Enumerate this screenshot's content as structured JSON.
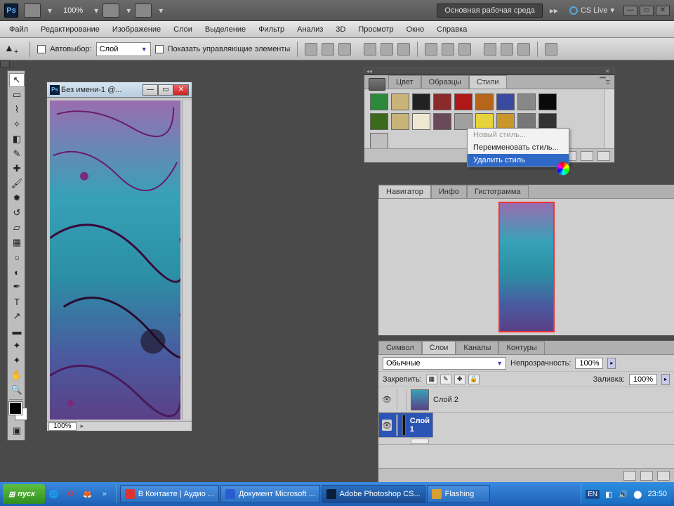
{
  "titlebar": {
    "app_initials": "Ps",
    "zoom": "100%",
    "workspace": "Основная рабочая среда",
    "cslive": "CS Live",
    "arrow": "▸▸"
  },
  "menu": {
    "items": [
      "Файл",
      "Редактирование",
      "Изображение",
      "Слои",
      "Выделение",
      "Фильтр",
      "Анализ",
      "3D",
      "Просмотр",
      "Окно",
      "Справка"
    ]
  },
  "options": {
    "autoselect_label": "Автовыбор:",
    "autoselect_value": "Слой",
    "show_controls_label": "Показать управляющие элементы"
  },
  "document": {
    "title": "Без имени-1 @...",
    "zoom": "100%"
  },
  "styles_panel": {
    "tabs": [
      "Цвет",
      "Образцы",
      "Стили"
    ],
    "active_tab": 2,
    "swatches": [
      "#2c8a3a",
      "#c8b478",
      "#222222",
      "#8a2a2a",
      "#b01818",
      "#b8651c",
      "#3a4aa0",
      "#888888",
      "#0a0a0a",
      "#3a6a1a",
      "#c8b478",
      "#efe7cf",
      "#6a4a5a",
      "#a0a0a0",
      "#e6d23a",
      "#c8962a",
      "#777777",
      "#333333",
      "#bfbfbf"
    ]
  },
  "context_menu": {
    "items": [
      {
        "label": "Новый стиль...",
        "disabled": true
      },
      {
        "label": "Переименовать стиль...",
        "disabled": false
      },
      {
        "label": "Удалить стиль",
        "hover": true
      }
    ]
  },
  "navigator": {
    "tabs": [
      "Навигатор",
      "Инфо",
      "Гистограмма"
    ],
    "active_tab": 0
  },
  "layers_panel": {
    "tabs": [
      "Символ",
      "Слои",
      "Каналы",
      "Контуры"
    ],
    "active_tab": 1,
    "blend_mode": "Обычные",
    "opacity_label": "Непрозрачность:",
    "opacity_value": "100%",
    "lock_label": "Закрепить:",
    "fill_label": "Заливка:",
    "fill_value": "100%",
    "layers": [
      {
        "name": "Слой 2",
        "selected": false,
        "thumb": "img"
      },
      {
        "name": "Слой 1",
        "selected": true,
        "thumb": "bk"
      }
    ]
  },
  "taskbar": {
    "start": "пуск",
    "tasks": [
      {
        "label": "В Контакте | Аудио ...",
        "color": "#d33",
        "active": false
      },
      {
        "label": "Документ Microsoft ...",
        "color": "#2a5bd0",
        "active": false
      },
      {
        "label": "Adobe Photoshop CS...",
        "color": "#0a1f3a",
        "active": true
      },
      {
        "label": "Flashing",
        "color": "#d8a030",
        "active": false
      }
    ],
    "lang": "EN",
    "time": "23:50"
  }
}
